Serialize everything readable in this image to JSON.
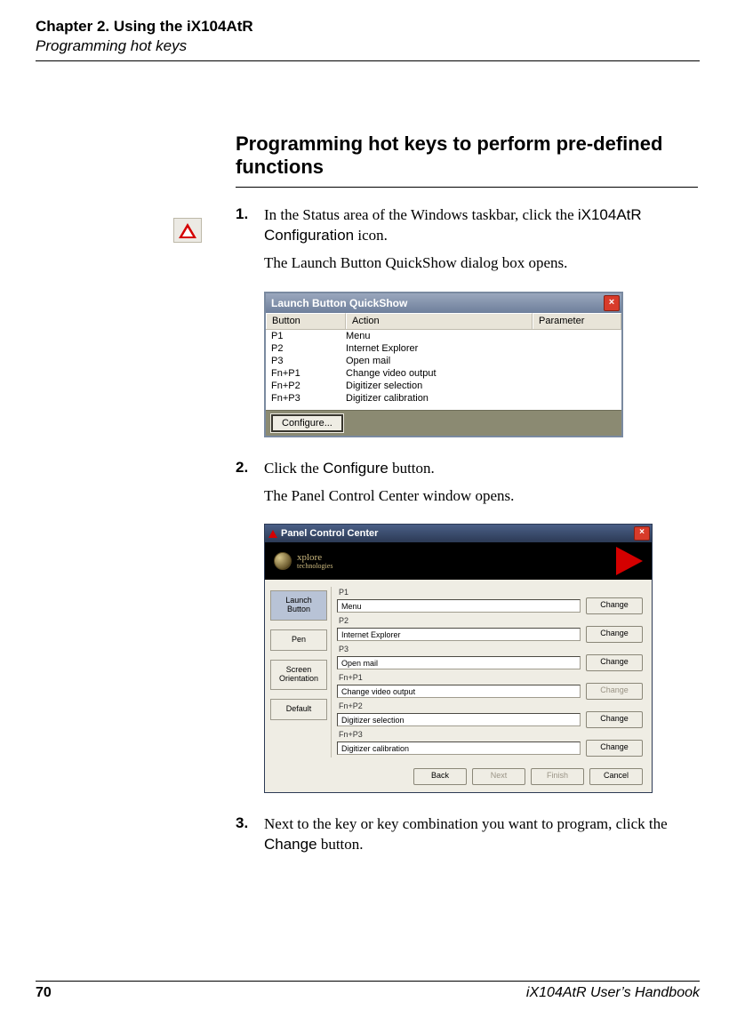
{
  "header": {
    "chapter": "Chapter 2. Using the iX104AtR",
    "section": "Programming hot keys"
  },
  "heading": "Programming hot keys to perform pre-defined functions",
  "steps": {
    "s1": {
      "num": "1.",
      "line1a": "In the Status area of the Windows taskbar, click the ",
      "line1b": "iX104AtR Configuration",
      "line1c": " icon.",
      "line2": "The Launch Button QuickShow dialog box opens."
    },
    "s2": {
      "num": "2.",
      "line1a": "Click the ",
      "line1b": "Configure",
      "line1c": " button.",
      "line2": "The Panel Control Center window opens."
    },
    "s3": {
      "num": "3.",
      "line1a": "Next to the key or key combination you want to program, click the ",
      "line1b": "Change",
      "line1c": " button."
    }
  },
  "quickshow": {
    "title": "Launch Button QuickShow",
    "close": "×",
    "headers": {
      "button": "Button",
      "action": "Action",
      "param": "Parameter"
    },
    "rows": [
      {
        "btn": "P1",
        "act": "Menu"
      },
      {
        "btn": "P2",
        "act": "Internet Explorer"
      },
      {
        "btn": "P3",
        "act": "Open mail"
      },
      {
        "btn": "Fn+P1",
        "act": "Change video output"
      },
      {
        "btn": "Fn+P2",
        "act": "Digitizer selection"
      },
      {
        "btn": "Fn+P3",
        "act": "Digitizer calibration"
      }
    ],
    "configure": "Configure..."
  },
  "pcc": {
    "title": "Panel Control Center",
    "close": "×",
    "brand_line1": "xplore",
    "brand_line2": "technologies",
    "tabs": {
      "launch": "Launch\nButton",
      "pen": "Pen",
      "screen": "Screen\nOrientation",
      "default": "Default"
    },
    "rows": [
      {
        "label": "P1",
        "value": "Menu",
        "btn": "Change",
        "disabled": false
      },
      {
        "label": "P2",
        "value": "Internet Explorer",
        "btn": "Change",
        "disabled": false
      },
      {
        "label": "P3",
        "value": "Open mail",
        "btn": "Change",
        "disabled": false
      },
      {
        "label": "Fn+P1",
        "value": "Change video output",
        "btn": "Change",
        "disabled": true
      },
      {
        "label": "Fn+P2",
        "value": "Digitizer selection",
        "btn": "Change",
        "disabled": false
      },
      {
        "label": "Fn+P3",
        "value": "Digitizer calibration",
        "btn": "Change",
        "disabled": false
      }
    ],
    "footer": {
      "back": "Back",
      "next": "Next",
      "finish": "Finish",
      "cancel": "Cancel"
    }
  },
  "footer": {
    "page": "70",
    "book": "iX104AtR User’s Handbook"
  }
}
